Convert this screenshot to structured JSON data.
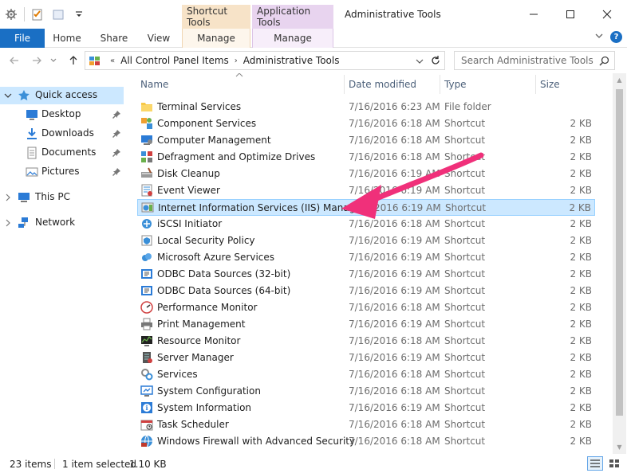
{
  "window": {
    "title": "Administrative Tools",
    "contextual_tabs": [
      "Shortcut Tools",
      "Application Tools"
    ]
  },
  "ribbon": {
    "tabs": [
      "File",
      "Home",
      "Share",
      "View",
      "Manage",
      "Manage"
    ],
    "help": "?"
  },
  "address": {
    "breadcrumbs": [
      "All Control Panel Items",
      "Administrative Tools"
    ]
  },
  "search": {
    "placeholder": "Search Administrative Tools"
  },
  "nav": {
    "quick_access": "Quick access",
    "pinned": [
      "Desktop",
      "Downloads",
      "Documents",
      "Pictures"
    ],
    "this_pc": "This PC",
    "network": "Network"
  },
  "columns": {
    "name": "Name",
    "date": "Date modified",
    "type": "Type",
    "size": "Size"
  },
  "files": [
    {
      "name": "Terminal Services",
      "date": "7/16/2016 6:23 AM",
      "type": "File folder",
      "size": "",
      "icon": "folder-icon"
    },
    {
      "name": "Component Services",
      "date": "7/16/2016 6:18 AM",
      "type": "Shortcut",
      "size": "2 KB",
      "icon": "component-services-icon"
    },
    {
      "name": "Computer Management",
      "date": "7/16/2016 6:18 AM",
      "type": "Shortcut",
      "size": "2 KB",
      "icon": "computer-management-icon"
    },
    {
      "name": "Defragment and Optimize Drives",
      "date": "7/16/2016 6:18 AM",
      "type": "Shortcut",
      "size": "2 KB",
      "icon": "defragment-icon"
    },
    {
      "name": "Disk Cleanup",
      "date": "7/16/2016 6:19 AM",
      "type": "Shortcut",
      "size": "2 KB",
      "icon": "disk-cleanup-icon"
    },
    {
      "name": "Event Viewer",
      "date": "7/16/2016 6:19 AM",
      "type": "Shortcut",
      "size": "2 KB",
      "icon": "event-viewer-icon"
    },
    {
      "name": "Internet Information Services (IIS) Manager",
      "date": "7/16/2016 6:19 AM",
      "type": "Shortcut",
      "size": "2 KB",
      "icon": "iis-manager-icon",
      "selected": true
    },
    {
      "name": "iSCSI Initiator",
      "date": "7/16/2016 6:18 AM",
      "type": "Shortcut",
      "size": "2 KB",
      "icon": "iscsi-icon"
    },
    {
      "name": "Local Security Policy",
      "date": "7/16/2016 6:19 AM",
      "type": "Shortcut",
      "size": "2 KB",
      "icon": "security-policy-icon"
    },
    {
      "name": "Microsoft Azure Services",
      "date": "7/16/2016 6:19 AM",
      "type": "Shortcut",
      "size": "2 KB",
      "icon": "azure-icon"
    },
    {
      "name": "ODBC Data Sources (32-bit)",
      "date": "7/16/2016 6:19 AM",
      "type": "Shortcut",
      "size": "2 KB",
      "icon": "odbc-icon"
    },
    {
      "name": "ODBC Data Sources (64-bit)",
      "date": "7/16/2016 6:19 AM",
      "type": "Shortcut",
      "size": "2 KB",
      "icon": "odbc-icon"
    },
    {
      "name": "Performance Monitor",
      "date": "7/16/2016 6:18 AM",
      "type": "Shortcut",
      "size": "2 KB",
      "icon": "performance-monitor-icon"
    },
    {
      "name": "Print Management",
      "date": "7/16/2016 6:19 AM",
      "type": "Shortcut",
      "size": "2 KB",
      "icon": "printer-icon"
    },
    {
      "name": "Resource Monitor",
      "date": "7/16/2016 6:18 AM",
      "type": "Shortcut",
      "size": "2 KB",
      "icon": "resource-monitor-icon"
    },
    {
      "name": "Server Manager",
      "date": "7/16/2016 6:19 AM",
      "type": "Shortcut",
      "size": "2 KB",
      "icon": "server-manager-icon"
    },
    {
      "name": "Services",
      "date": "7/16/2016 6:18 AM",
      "type": "Shortcut",
      "size": "2 KB",
      "icon": "services-icon"
    },
    {
      "name": "System Configuration",
      "date": "7/16/2016 6:18 AM",
      "type": "Shortcut",
      "size": "2 KB",
      "icon": "system-configuration-icon"
    },
    {
      "name": "System Information",
      "date": "7/16/2016 6:19 AM",
      "type": "Shortcut",
      "size": "2 KB",
      "icon": "system-information-icon"
    },
    {
      "name": "Task Scheduler",
      "date": "7/16/2016 6:18 AM",
      "type": "Shortcut",
      "size": "2 KB",
      "icon": "task-scheduler-icon"
    },
    {
      "name": "Windows Firewall with Advanced Security",
      "date": "7/16/2016 6:18 AM",
      "type": "Shortcut",
      "size": "2 KB",
      "icon": "firewall-icon"
    }
  ],
  "status": {
    "count": "23 items",
    "selection": "1 item selected",
    "size": "1.10 KB"
  },
  "colors": {
    "accent": "#1a6fc4",
    "selection": "#cce8ff",
    "annotation_arrow": "#f0307a"
  }
}
